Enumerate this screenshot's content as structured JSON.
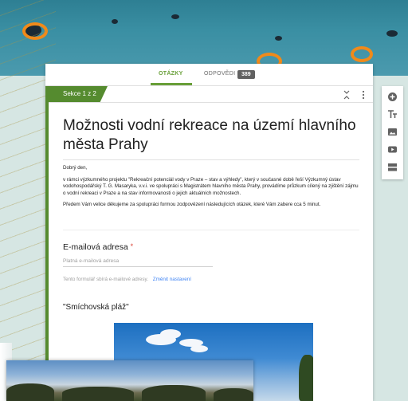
{
  "tabs": {
    "questions": "OTÁZKY",
    "responses": "ODPOVĚDI",
    "responses_count": "389"
  },
  "section": {
    "label": "Sekce 1 z 2"
  },
  "form": {
    "title": "Možnosti vodní rekreace na území hlavního města Prahy",
    "greeting": "Dobrý den,",
    "paragraph1": "v rámci výzkumného projektu \"Rekreační potenciál vody v Praze – stav a výhledy\", který v současné době řeší Výzkumný ústav vodohospodářský T. G. Masaryka, v.v.i. ve spolupráci s Magistrátem hlavního města Prahy, provádíme průzkum cílený na zjištění zájmu o vodní rekreaci v Praze a na stav informovanosti o jejich aktuálních možnostech.",
    "paragraph2": "Předem Vám velice děkujeme za spolupráci formou zodpovězení následujících otázek, které Vám zabere cca 5 minut."
  },
  "email_question": {
    "title": "E-mailová adresa",
    "required_mark": "*",
    "placeholder": "Platná e-mailová adresa",
    "collect_note": "Tento formulář sbírá e-mailové adresy.",
    "change_link": "Změnit nastavení"
  },
  "image_question": {
    "title": "\"Smíchovská pláž\""
  },
  "toolbar": {
    "icons": [
      "add-question-icon",
      "add-title-icon",
      "add-image-icon",
      "add-video-icon",
      "add-section-icon"
    ]
  },
  "colors": {
    "accent": "#689f38",
    "section_banner": "#558b2f",
    "link": "#4285f4",
    "required": "#db4437"
  }
}
